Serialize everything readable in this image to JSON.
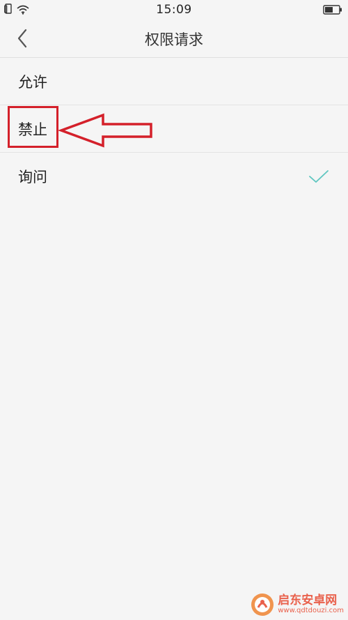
{
  "status_bar": {
    "time": "15:09",
    "icons": [
      "sim-icon",
      "wifi-icon",
      "battery-icon"
    ]
  },
  "header": {
    "back_icon": "chevron-left-icon",
    "title": "权限请求"
  },
  "options": [
    {
      "label": "允许",
      "selected": false
    },
    {
      "label": "禁止",
      "selected": false
    },
    {
      "label": "询问",
      "selected": true
    }
  ],
  "annotation": {
    "highlight_color": "#d4202a",
    "target": "禁止"
  },
  "colors": {
    "background": "#f5f5f5",
    "check": "#5fc6c0",
    "annotation": "#d4202a"
  },
  "watermark": {
    "name": "启东安卓网",
    "url": "www.qdtdouzi.com"
  }
}
